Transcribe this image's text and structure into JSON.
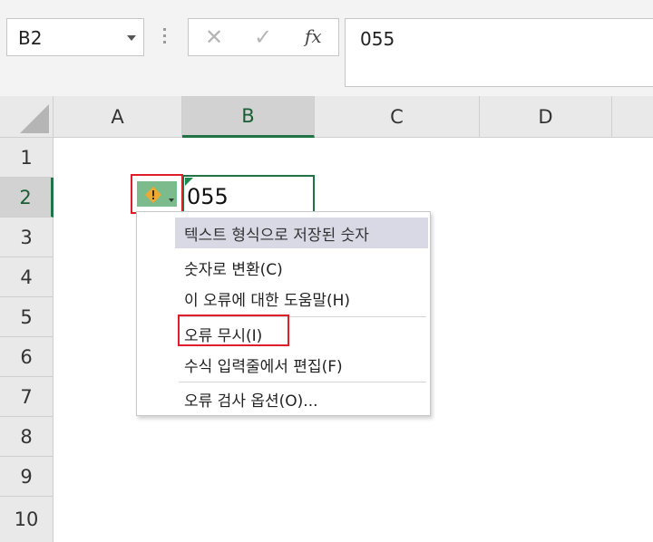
{
  "formula_bar": {
    "name_box": "B2",
    "cancel_glyph": "✕",
    "enter_glyph": "✓",
    "fx_label": "fx",
    "formula_value": "055"
  },
  "columns": [
    "A",
    "B",
    "C",
    "D"
  ],
  "rows": [
    "1",
    "2",
    "3",
    "4",
    "5",
    "6",
    "7",
    "8",
    "9",
    "10"
  ],
  "cell_b2": "055",
  "error_button": {
    "icon": "warning-diamond-icon",
    "color": "#f0a830"
  },
  "menu": {
    "header": "텍스트 형식으로 저장된 숫자",
    "items": [
      "숫자로 변환(C)",
      "이 오류에 대한 도움말(H)",
      "오류 무시(I)",
      "수식 입력줄에서 편집(F)",
      "오류 검사 옵션(O)..."
    ]
  },
  "colors": {
    "accent_green": "#217346",
    "highlight_red": "#e01e2b",
    "menu_header_bg": "#d9d9e6"
  }
}
